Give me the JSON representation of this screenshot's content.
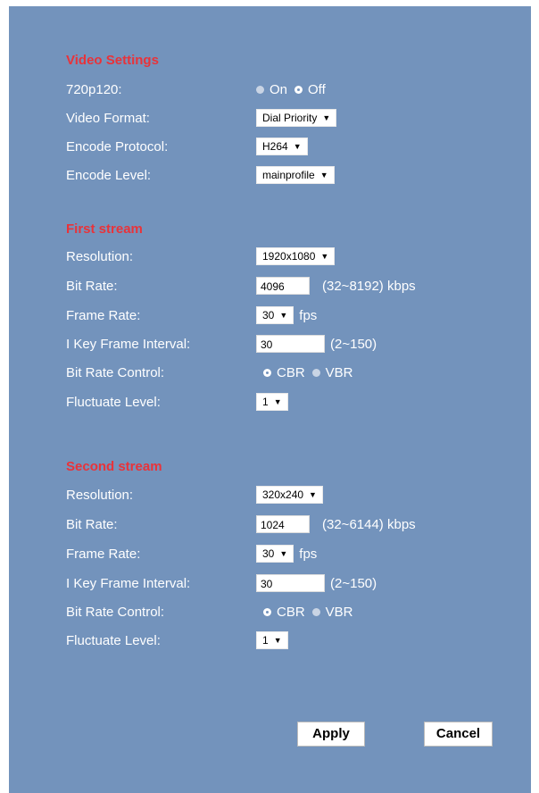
{
  "video_settings": {
    "title": "Video Settings",
    "r720p120": {
      "label": "720p120:",
      "opt_on": "On",
      "opt_off": "Off",
      "selected": "Off"
    },
    "video_format": {
      "label": "Video Format:",
      "value": "Dial Priority"
    },
    "encode_protocol": {
      "label": "Encode Protocol:",
      "value": "H264"
    },
    "encode_level": {
      "label": "Encode Level:",
      "value": "mainprofile"
    }
  },
  "first_stream": {
    "title": "First stream",
    "resolution": {
      "label": "Resolution:",
      "value": "1920x1080"
    },
    "bit_rate": {
      "label": "Bit Rate:",
      "value": "4096",
      "range": "(32~8192) kbps"
    },
    "frame_rate": {
      "label": "Frame Rate:",
      "value": "30",
      "unit": "fps"
    },
    "key_interval": {
      "label": "I Key Frame Interval:",
      "value": "30",
      "range": "(2~150)"
    },
    "bit_rate_control": {
      "label": "Bit Rate Control:",
      "opt_cbr": "CBR",
      "opt_vbr": "VBR",
      "selected": "CBR"
    },
    "fluctuate_level": {
      "label": "Fluctuate Level:",
      "value": "1"
    }
  },
  "second_stream": {
    "title": "Second stream",
    "resolution": {
      "label": "Resolution:",
      "value": "320x240"
    },
    "bit_rate": {
      "label": "Bit Rate:",
      "value": "1024",
      "range": "(32~6144) kbps"
    },
    "frame_rate": {
      "label": "Frame Rate:",
      "value": "30",
      "unit": "fps"
    },
    "key_interval": {
      "label": "I Key Frame Interval:",
      "value": "30",
      "range": "(2~150)"
    },
    "bit_rate_control": {
      "label": "Bit Rate Control:",
      "opt_cbr": "CBR",
      "opt_vbr": "VBR",
      "selected": "CBR"
    },
    "fluctuate_level": {
      "label": "Fluctuate Level:",
      "value": "1"
    }
  },
  "buttons": {
    "apply": "Apply",
    "cancel": "Cancel"
  },
  "colors": {
    "panel_bg": "#7393bc",
    "section_title": "#e8333a"
  }
}
